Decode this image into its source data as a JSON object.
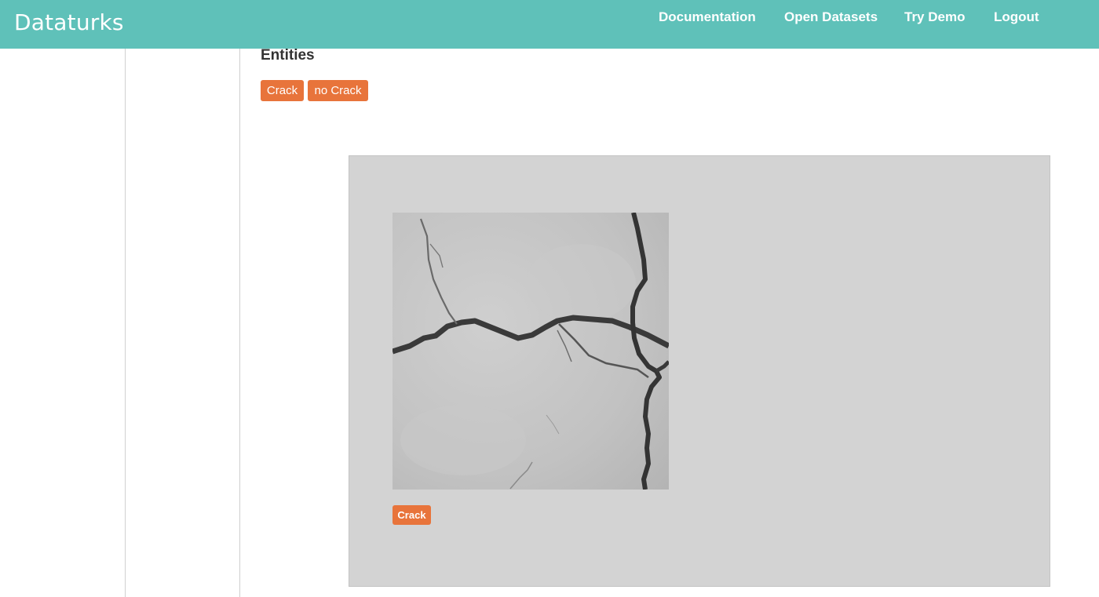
{
  "app": {
    "brand": "Dataturks"
  },
  "nav": {
    "items": [
      {
        "label": "Documentation"
      },
      {
        "label": "Open Datasets"
      },
      {
        "label": "Try Demo"
      },
      {
        "label": "Logout"
      }
    ]
  },
  "entities": {
    "title": "Entities",
    "items": [
      {
        "label": "Crack"
      },
      {
        "label": "no Crack"
      }
    ]
  },
  "annotation": {
    "selected_label": "Crack"
  },
  "colors": {
    "navbar": "#5fc1b9",
    "entity_tag": "#e8743b",
    "panel": "#d3d3d3"
  }
}
